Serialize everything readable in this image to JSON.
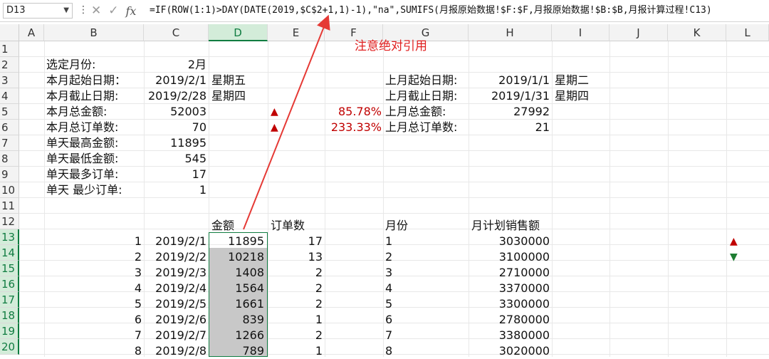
{
  "formula_bar": {
    "name_box": "D13",
    "formula": "=IF(ROW(1:1)>DAY(DATE(2019,$C$2+1,1)-1),\"na\",SUMIFS(月报原始数据!$F:$F,月报原始数据!$B:$B,月报计算过程!C13)"
  },
  "columns": [
    "A",
    "B",
    "C",
    "D",
    "E",
    "F",
    "G",
    "H",
    "I",
    "J",
    "K",
    "L"
  ],
  "rows": [
    "1",
    "2",
    "3",
    "4",
    "5",
    "6",
    "7",
    "8",
    "9",
    "10",
    "11",
    "12",
    "13",
    "14",
    "15",
    "16",
    "17",
    "18",
    "19",
    "20"
  ],
  "annotation": "注意绝对引用",
  "summary": {
    "b2": "选定月份:",
    "c2": "2月",
    "b3": "本月起始日期：",
    "c3": "2019/2/1",
    "d3": "星期五",
    "b4": "本月截止日期:",
    "c4": "2019/2/28",
    "d4": "星期四",
    "b5": "本月总金额:",
    "c5": "52003",
    "f5": "85.78%",
    "b6": "本月总订单数:",
    "c6": "70",
    "f6": "233.33%",
    "b7": "单天最高金额:",
    "c7": "11895",
    "b8": "单天最低金额:",
    "c8": "545",
    "b9": "单天最多订单:",
    "c9": "17",
    "b10": "单天 最少订单:",
    "c10": "1",
    "g3": "上月起始日期:",
    "h3": "2019/1/1",
    "i3": "星期二",
    "g4": "上月截止日期:",
    "h4": "2019/1/31",
    "i4": "星期四",
    "g5": "上月总金额:",
    "h5": "27992",
    "g6": "上月总订单数:",
    "h6": "21"
  },
  "table": {
    "headers": {
      "d": "金额",
      "e": "订单数",
      "g": "月份",
      "h": "月计划销售额"
    },
    "rows": [
      {
        "b": "1",
        "c": "2019/2/1",
        "d": "11895",
        "e": "17",
        "g": "1",
        "h": "3030000"
      },
      {
        "b": "2",
        "c": "2019/2/2",
        "d": "10218",
        "e": "13",
        "g": "2",
        "h": "3100000"
      },
      {
        "b": "3",
        "c": "2019/2/3",
        "d": "1408",
        "e": "2",
        "g": "3",
        "h": "2710000"
      },
      {
        "b": "4",
        "c": "2019/2/4",
        "d": "1564",
        "e": "2",
        "g": "4",
        "h": "3370000"
      },
      {
        "b": "5",
        "c": "2019/2/5",
        "d": "1661",
        "e": "2",
        "g": "5",
        "h": "3300000"
      },
      {
        "b": "6",
        "c": "2019/2/6",
        "d": "839",
        "e": "1",
        "g": "6",
        "h": "2780000"
      },
      {
        "b": "7",
        "c": "2019/2/7",
        "d": "1266",
        "e": "2",
        "g": "7",
        "h": "3380000"
      },
      {
        "b": "8",
        "c": "2019/2/8",
        "d": "789",
        "e": "1",
        "g": "8",
        "h": "3020000"
      }
    ]
  },
  "indicators": {
    "up_color": "#c00000",
    "down_color": "#1e7d32",
    "accent": "#107c41"
  }
}
